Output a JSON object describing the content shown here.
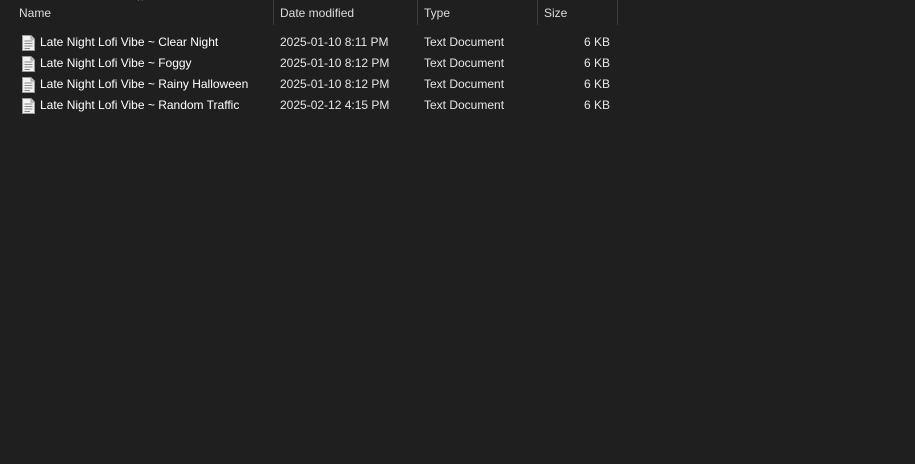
{
  "columns": {
    "name": "Name",
    "date": "Date modified",
    "type": "Type",
    "size": "Size"
  },
  "sort": {
    "column": "name",
    "indicator": "^"
  },
  "files": [
    {
      "name": "Late Night Lofi Vibe ~ Clear Night",
      "date": "2025-01-10 8:11 PM",
      "type": "Text Document",
      "size": "6 KB",
      "icon": "text-document-icon"
    },
    {
      "name": "Late Night Lofi Vibe ~ Foggy",
      "date": "2025-01-10 8:12 PM",
      "type": "Text Document",
      "size": "6 KB",
      "icon": "text-document-icon"
    },
    {
      "name": "Late Night Lofi Vibe ~ Rainy Halloween",
      "date": "2025-01-10 8:12 PM",
      "type": "Text Document",
      "size": "6 KB",
      "icon": "text-document-icon"
    },
    {
      "name": "Late Night Lofi Vibe ~ Random Traffic",
      "date": "2025-02-12 4:15 PM",
      "type": "Text Document",
      "size": "6 KB",
      "icon": "text-document-icon"
    }
  ],
  "colors": {
    "background": "#1f1f1f",
    "text": "#ffffff",
    "header_text": "#dcdcdc",
    "separator": "#3b3b3b"
  }
}
